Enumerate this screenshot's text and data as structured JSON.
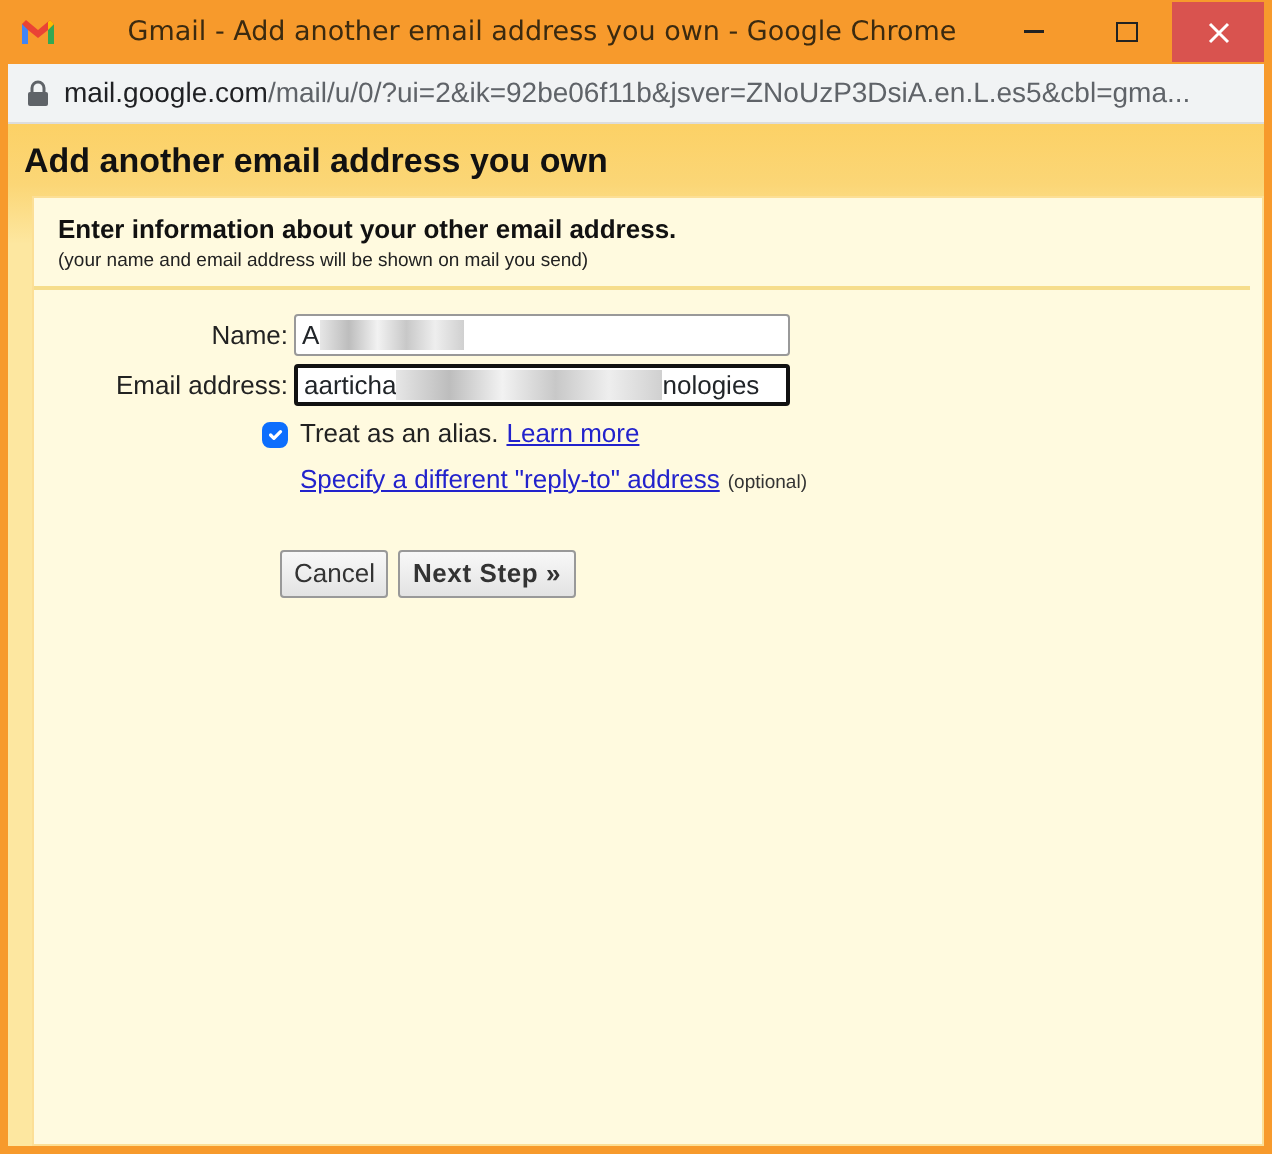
{
  "window": {
    "title": "Gmail - Add another email address you own - Google Chrome"
  },
  "address_bar": {
    "url_host": "mail.google.com",
    "url_rest": "/mail/u/0/?ui=2&ik=92be06f11b&jsver=ZNoUzP3DsiA.en.L.es5&cbl=gma..."
  },
  "dialog": {
    "title": "Add another email address you own",
    "heading": "Enter information about your other email address.",
    "subheading": "(your name and email address will be shown on mail you send)"
  },
  "fields": [
    {
      "label": "Name:",
      "value_start": "A",
      "redacted": true,
      "focused": false
    },
    {
      "label": "Email address:",
      "value_start": "aarticha",
      "value_end": "nologies",
      "redacted": true,
      "focused": true
    }
  ],
  "alias": {
    "label": "Treat as an alias.",
    "checked": true,
    "link": "Learn more"
  },
  "reply_to": {
    "link": "Specify a different \"reply-to\" address",
    "note": "(optional)"
  },
  "buttons": [
    {
      "label": "Cancel",
      "kind": "plain"
    },
    {
      "label": "Next Step »",
      "kind": "primary"
    }
  ]
}
